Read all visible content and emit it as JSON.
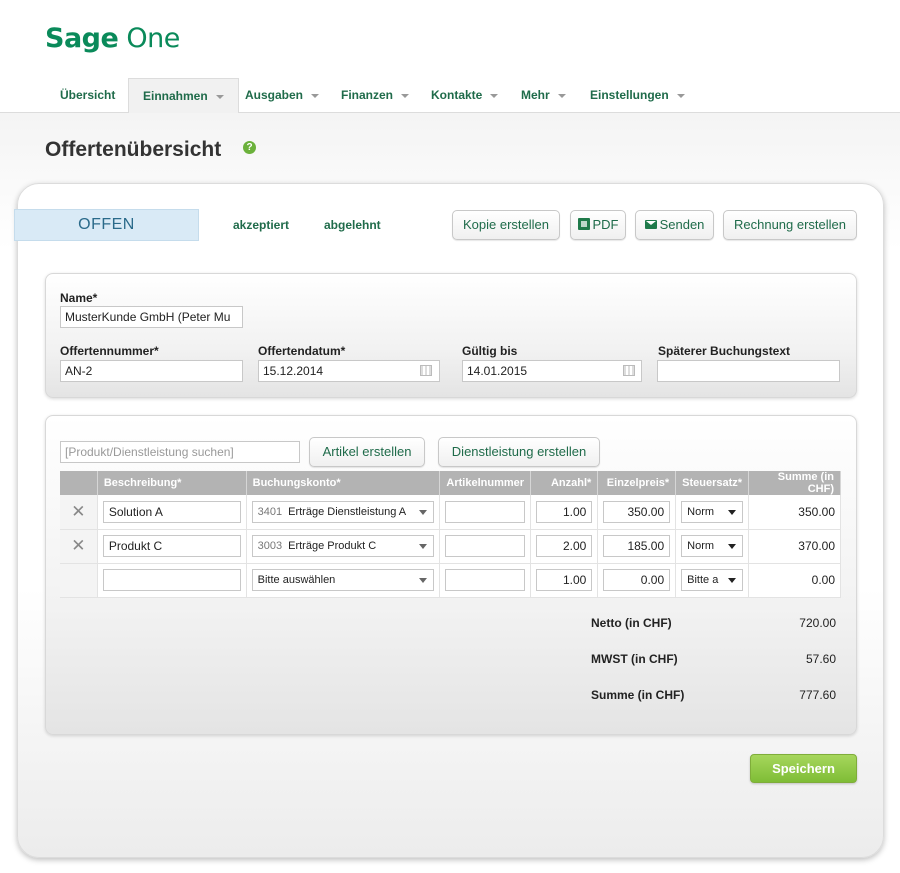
{
  "app": {
    "logo_bold": "Sage",
    "logo_light": " One"
  },
  "nav": {
    "items": [
      {
        "label": "Übersicht",
        "dropdown": false
      },
      {
        "label": "Einnahmen",
        "dropdown": true,
        "active": true
      },
      {
        "label": "Ausgaben",
        "dropdown": true
      },
      {
        "label": "Finanzen",
        "dropdown": true
      },
      {
        "label": "Kontakte",
        "dropdown": true
      },
      {
        "label": "Mehr",
        "dropdown": true
      },
      {
        "label": "Einstellungen",
        "dropdown": true
      }
    ]
  },
  "page": {
    "title": "Offertenübersicht",
    "help": "?"
  },
  "status": {
    "current": "OFFEN",
    "accepted": "akzeptiert",
    "rejected": "abgelehnt"
  },
  "actions": {
    "copy": "Kopie erstellen",
    "pdf": "PDF",
    "send": "Senden",
    "invoice": "Rechnung erstellen"
  },
  "form": {
    "name_label": "Name*",
    "name_value": "MusterKunde GmbH (Peter Mu",
    "number_label": "Offertennummer*",
    "number_value": "AN-2",
    "date_label": "Offertendatum*",
    "date_value": "15.12.2014",
    "valid_label": "Gültig bis",
    "valid_value": "14.01.2015",
    "booking_label": "Späterer Buchungstext",
    "booking_value": ""
  },
  "items": {
    "search_placeholder": "[Produkt/Dienstleistung suchen]",
    "create_article": "Artikel erstellen",
    "create_service": "Dienstleistung erstellen",
    "columns": {
      "description": "Beschreibung*",
      "account": "Buchungskonto*",
      "article_no": "Artikelnummer",
      "quantity": "Anzahl*",
      "unit_price": "Einzelpreis*",
      "tax": "Steuersatz*",
      "sum": "Summe (in CHF)"
    },
    "rows": [
      {
        "description": "Solution A",
        "account_no": "3401",
        "account": "Erträge Dienstleistung A",
        "article_no": "",
        "quantity": "1.00",
        "unit_price": "350.00",
        "tax": "Norm",
        "sum": "350.00"
      },
      {
        "description": "Produkt C",
        "account_no": "3003",
        "account": "Erträge Produkt C",
        "article_no": "",
        "quantity": "2.00",
        "unit_price": "185.00",
        "tax": "Norm",
        "sum": "370.00"
      },
      {
        "description": "",
        "account_no": "",
        "account": "Bitte auswählen",
        "article_no": "",
        "quantity": "1.00",
        "unit_price": "0.00",
        "tax": "Bitte a",
        "sum": "0.00"
      }
    ]
  },
  "totals": {
    "net_label": "Netto (in CHF)",
    "net_value": "720.00",
    "vat_label": "MWST (in CHF)",
    "vat_value": "57.60",
    "sum_label": "Summe (in CHF)",
    "sum_value": "777.60"
  },
  "save": "Speichern",
  "colors": {
    "brand": "#0a8a5a",
    "link": "#1f6b4a",
    "save": "#8cc540",
    "status_tab": "#d9eaf6"
  }
}
